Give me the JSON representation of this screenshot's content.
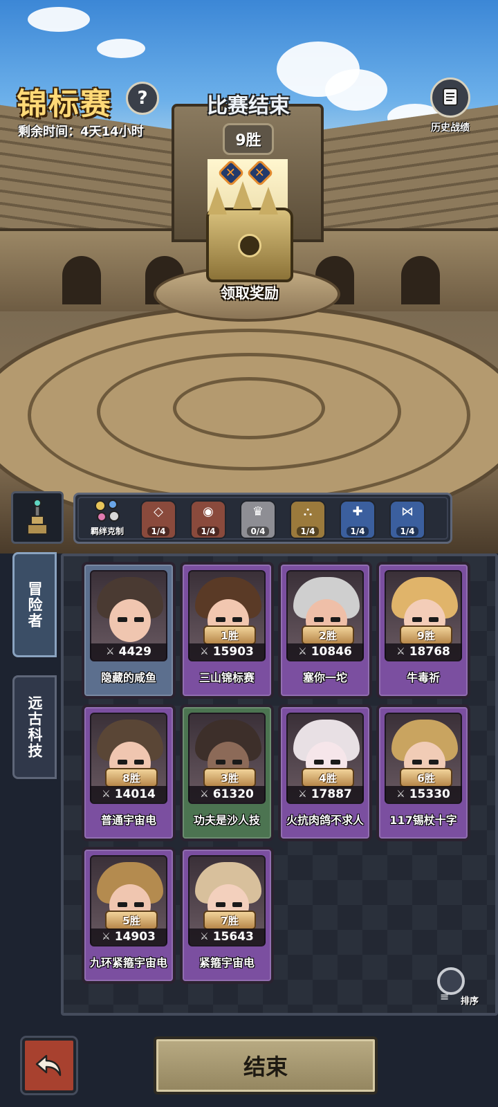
{
  "header": {
    "title": "锦标赛",
    "help_symbol": "?",
    "time_remaining": "剩余时间：4天14小时",
    "history_label": "历史战绩"
  },
  "match": {
    "status": "比赛结束",
    "wins": "9胜",
    "losses": [
      "✕",
      "✕"
    ],
    "claim_reward": "领取奖励"
  },
  "synergy": {
    "bond_label": "羁绊克制",
    "items": [
      {
        "icon": "diamond-icon",
        "glyph": "◇",
        "count": "1/4",
        "color": "#8a4a3c"
      },
      {
        "icon": "eye-icon",
        "glyph": "◉",
        "count": "1/4",
        "color": "#8a4a3c"
      },
      {
        "icon": "crown-icon",
        "glyph": "♛",
        "count": "0/4",
        "color": "#8e8e94"
      },
      {
        "icon": "flame-icon",
        "glyph": "⛬",
        "count": "1/4",
        "color": "#9b7a3c"
      },
      {
        "icon": "spiral-icon",
        "glyph": "✚",
        "count": "1/4",
        "color": "#3b5f9e"
      },
      {
        "icon": "bowtie-icon",
        "glyph": "⋈",
        "count": "1/4",
        "color": "#3b5f9e"
      }
    ]
  },
  "tabs": {
    "adventurer": "冒险者",
    "ancient_tech": "远古科技"
  },
  "roster": [
    {
      "name": "隐藏的咸鱼",
      "power": "4429",
      "wins": "",
      "frame": "blue",
      "hair": "#4a3a32",
      "skin": "#f0c6b0"
    },
    {
      "name": "三山锦标赛",
      "power": "15903",
      "wins": "1胜",
      "frame": "purple",
      "hair": "#5a3a26",
      "skin": "#f2c7b0"
    },
    {
      "name": "塞你一坨",
      "power": "10846",
      "wins": "2胜",
      "frame": "purple",
      "hair": "#cfcfcf",
      "skin": "#efbfa8"
    },
    {
      "name": "牛毒祈",
      "power": "18768",
      "wins": "9胜",
      "frame": "purple",
      "hair": "#e0b46a",
      "skin": "#f3cdb8"
    },
    {
      "name": "普通宇宙电",
      "power": "14014",
      "wins": "8胜",
      "frame": "purple",
      "hair": "#5a4636",
      "skin": "#f0c6b0"
    },
    {
      "name": "功夫是沙人技",
      "power": "61320",
      "wins": "3胜",
      "frame": "green",
      "hair": "#3d2f2a",
      "skin": "#8c6a58"
    },
    {
      "name": "火抗肉鸽不求人",
      "power": "17887",
      "wins": "4胜",
      "frame": "purple",
      "hair": "#e8e0e4",
      "skin": "#f6e6ea"
    },
    {
      "name": "117锡杖十字",
      "power": "15330",
      "wins": "6胜",
      "frame": "purple",
      "hair": "#c9a460",
      "skin": "#f1ccb6"
    },
    {
      "name": "九环紧箍宇宙电",
      "power": "14903",
      "wins": "5胜",
      "frame": "purple",
      "hair": "#b48b4f",
      "skin": "#f0c6b0"
    },
    {
      "name": "紧箍宇宙电",
      "power": "15643",
      "wins": "7胜",
      "frame": "purple",
      "hair": "#d8c09c",
      "skin": "#f3d0bd"
    }
  ],
  "sort_label": "排序",
  "end_button": "结束"
}
